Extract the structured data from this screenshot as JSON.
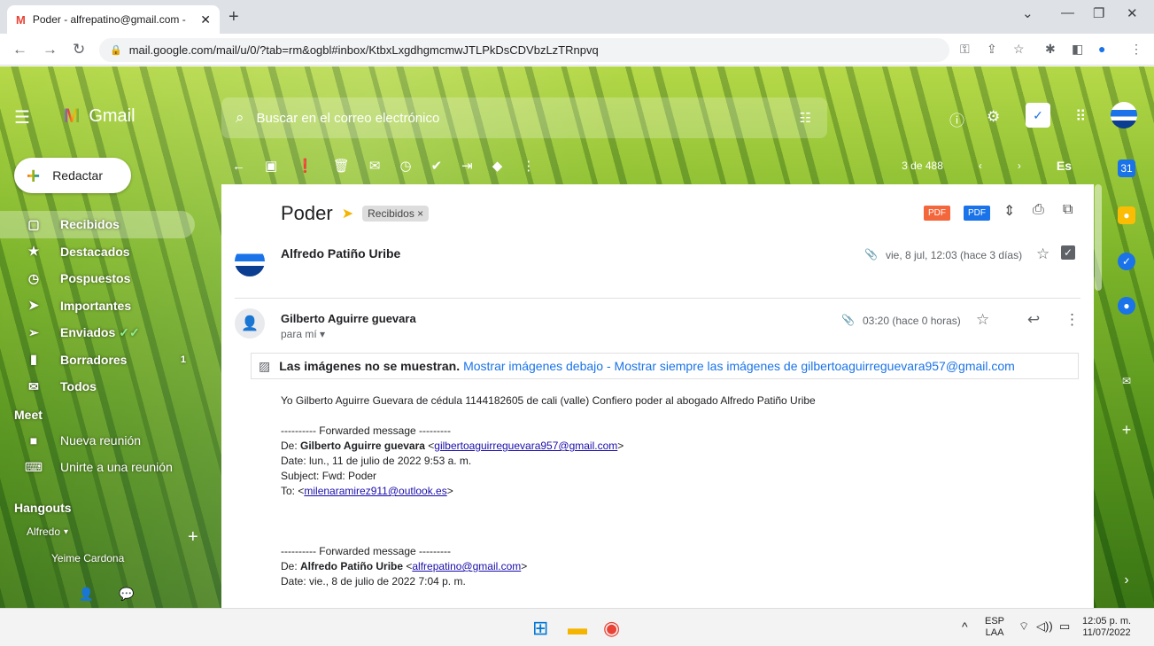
{
  "browser": {
    "tab_title": "Poder - alfrepatino@gmail.com -",
    "tab_favicon": "M",
    "url": "mail.google.com/mail/u/0/?tab=rm&ogbl#inbox/KtbxLxgdhgmcmwJTLPkDsCDVbzLzTRnpvq"
  },
  "header": {
    "app_name": "Gmail",
    "search_placeholder": "Buscar en el correo electrónico"
  },
  "compose_label": "Redactar",
  "sidebar": {
    "items": [
      {
        "label": "Recibidos",
        "icon": "inbox-icon",
        "active": true,
        "count": ""
      },
      {
        "label": "Destacados",
        "icon": "star-icon",
        "count": ""
      },
      {
        "label": "Pospuestos",
        "icon": "clock-icon",
        "count": ""
      },
      {
        "label": "Importantes",
        "icon": "important-icon",
        "count": ""
      },
      {
        "label": "Enviados",
        "icon": "send-icon",
        "count": ""
      },
      {
        "label": "Borradores",
        "icon": "draft-icon",
        "count": "1"
      },
      {
        "label": "Todos",
        "icon": "mail-icon",
        "count": ""
      }
    ],
    "meet_title": "Meet",
    "meet_items": [
      {
        "label": "Nueva reunión",
        "icon": "video-icon"
      },
      {
        "label": "Unirte a una reunión",
        "icon": "keyboard-icon"
      }
    ],
    "hangouts_title": "Hangouts",
    "hangouts_user": "Alfredo",
    "hangouts_contact": "Yeime Cardona"
  },
  "toolbar": {
    "pager": "3 de 488",
    "lang": "Es"
  },
  "thread": {
    "subject": "Poder",
    "label": "Recibidos ×",
    "pdf1": "PDF",
    "pdf2": "PDF",
    "msg1": {
      "sender": "Alfredo Patiño Uribe",
      "date": "vie, 8 jul, 12:03 (hace 3 días)"
    },
    "msg2": {
      "sender": "Gilberto Aguirre guevara",
      "to": "para mí",
      "date": "03:20 (hace 0 horas)"
    },
    "image_warning_bold": "Las imágenes no se muestran.",
    "image_warning_link1": "Mostrar imágenes debajo",
    "image_warning_sep": " - ",
    "image_warning_link2": "Mostrar siempre las imágenes de gilbertoaguirreguevara957@gmail.com",
    "body": {
      "line1": "Yo Gilberto Aguirre Guevara de cédula 1144182605 de cali (valle) Confiero poder al abogado Alfredo Patiño Uribe",
      "fwd1": "---------- Forwarded message ---------",
      "fwd1_de_label": "De: ",
      "fwd1_de_name": "Gilberto Aguirre guevara",
      "fwd1_de_email": "gilbertoaguirreguevara957@gmail.com",
      "fwd1_date": "Date: lun., 11 de julio de 2022 9:53 a. m.",
      "fwd1_subject": "Subject: Fwd: Poder",
      "fwd1_to_label": "To: ",
      "fwd1_to_email": "milenaramirez911@outlook.es",
      "fwd2": "---------- Forwarded message ---------",
      "fwd2_de_label": "De: ",
      "fwd2_de_name": "Alfredo Patiño Uribe",
      "fwd2_de_email": "alfrepatino@gmail.com",
      "fwd2_date": "Date: vie., 8 de julio de 2022 7:04 p. m."
    }
  },
  "taskbar": {
    "lang1": "ESP",
    "lang2": "LAA",
    "time": "12:05 p. m.",
    "date": "11/07/2022"
  },
  "colors": {
    "pdf_orange": "#f4663b",
    "pdf_blue": "#1a73e8",
    "link": "#1a73e8"
  }
}
